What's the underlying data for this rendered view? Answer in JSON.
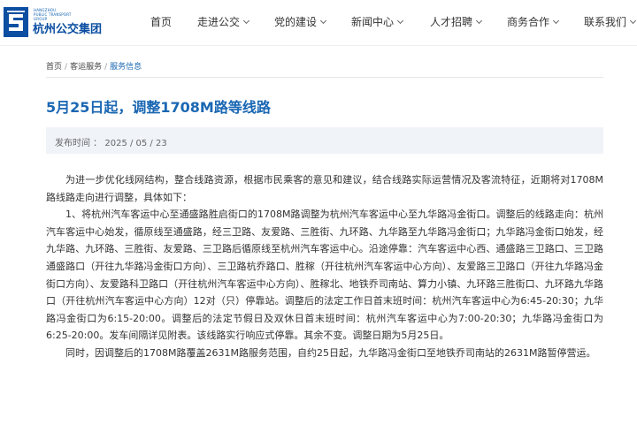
{
  "header": {
    "logo": {
      "en_text": "HANGZHOU\nPUBLIC TRANSPORT\nGROUP",
      "cn_text": "杭州公交集团",
      "brand_color": "#0b4ea2"
    },
    "nav": [
      {
        "label": "首页",
        "has_dropdown": false
      },
      {
        "label": "走进公交",
        "has_dropdown": true
      },
      {
        "label": "党的建设",
        "has_dropdown": true
      },
      {
        "label": "新闻中心",
        "has_dropdown": true
      },
      {
        "label": "人才招聘",
        "has_dropdown": true
      },
      {
        "label": "商务合作",
        "has_dropdown": true
      },
      {
        "label": "联系我们",
        "has_dropdown": true
      }
    ]
  },
  "breadcrumb": {
    "items": [
      "首页",
      "客运服务",
      "服务信息"
    ]
  },
  "article": {
    "title": "5月25日起，调整1708M路等线路",
    "meta": "发布时间 ： 2025 / 05 / 23",
    "paragraphs": [
      "为进一步优化线网结构，整合线路资源，根据市民乘客的意见和建议，结合线路实际运营情况及客流特征，近期将对1708M路线路走向进行调整，具体如下：",
      "1、将杭州汽车客运中心至通盛路胜启街口的1708M路调整为杭州汽车客运中心至九华路冯金街口。调整后的线路走向：杭州汽车客运中心始发，循原线至通盛路，经三卫路、友爱路、三胜街、九环路、九华路至九华路冯金街口；九华路冯金街口始发，经九华路、九环路、三胜街、友爱路、三卫路后循原线至杭州汽车客运中心。沿途停靠：汽车客运中心西、通盛路三卫路口、三卫路通盛路口（开往九华路冯金街口方向）、三卫路杭乔路口、胜稼（开往杭州汽车客运中心方向）、友爱路三卫路口（开往九华路冯金街口方向）、友爱路科卫路口（开往杭州汽车客运中心方向）、胜稼北、地铁乔司南站、算力小镇、九环路三胜街口、九环路九华路口（开往杭州汽车客运中心方向）12对（只）停靠站。调整后的法定工作日首末班时间：杭州汽车客运中心为6:45-20:30；九华路冯金街口为6:15-20:00。调整后的法定节假日及双休日首末班时间：杭州汽车客运中心为7:00-20:30；九华路冯金街口为6:25-20:00。发车间隔详见附表。该线路实行响应式停靠。其余不变。调整日期为5月25日。",
      "同时，因调整后的1708M路覆盖2631M路服务范围，自约25日起，九华路冯金街口至地铁乔司南站的2631M路暂停营运。"
    ]
  },
  "colors": {
    "accent": "#1a67b3",
    "meta_bg": "#f0f3f8"
  }
}
